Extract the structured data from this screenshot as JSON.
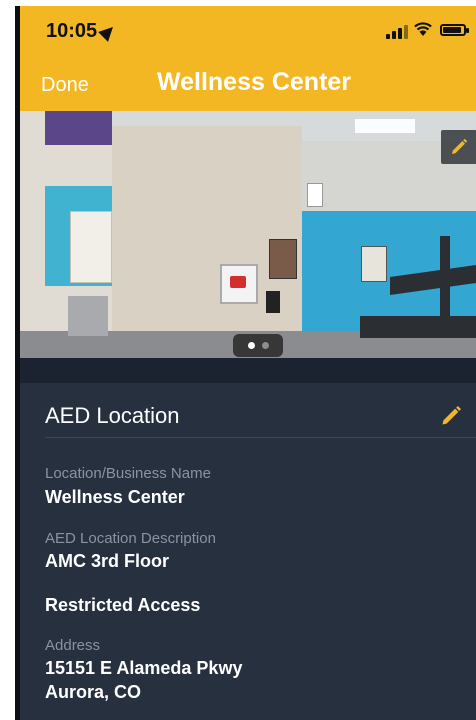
{
  "status_bar": {
    "time": "10:05",
    "location_icon": "location-arrow-icon",
    "signal_icon": "cellular-signal-icon",
    "wifi_icon": "wifi-icon",
    "battery_icon": "battery-icon"
  },
  "nav": {
    "done_label": "Done",
    "title": "Wellness Center",
    "background_color": "#f4b724"
  },
  "photo": {
    "alt": "AED location photo",
    "edit_icon": "pencil-icon",
    "page_count": 2,
    "current_page": 1
  },
  "section": {
    "title": "AED Location",
    "edit_icon": "pencil-icon",
    "accent_color": "#f4b724",
    "fields": [
      {
        "label": "Location/Business Name",
        "value": "Wellness Center"
      },
      {
        "label": "AED Location Description",
        "value": "AMC 3rd Floor"
      },
      {
        "label": "",
        "value": "Restricted Access"
      },
      {
        "label": "Address",
        "value": "15151 E Alameda Pkwy",
        "value2": "Aurora, CO"
      }
    ]
  }
}
